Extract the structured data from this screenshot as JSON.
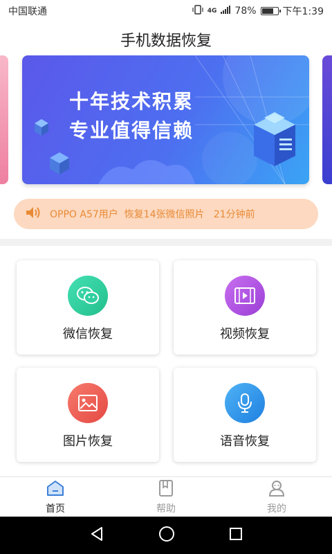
{
  "status_bar": {
    "carrier": "中国联通",
    "network": "4G",
    "battery": "78%",
    "battery_level": 0.78,
    "time": "下午1:39"
  },
  "app": {
    "title": "手机数据恢复"
  },
  "banner": {
    "line1": "十年技术积累",
    "line2": "专业值得信赖"
  },
  "notice": {
    "icon": "speaker-icon",
    "text": "OPPO A57用户  恢复14张微信照片   21分钟前",
    "color": "#e98a36",
    "background": "#fcd9c0"
  },
  "features": [
    {
      "label": "微信恢复",
      "icon": "wechat-icon",
      "color": "#2fcfa0"
    },
    {
      "label": "视频恢复",
      "icon": "video-icon",
      "color": "#b24fe0"
    },
    {
      "label": "图片恢复",
      "icon": "image-icon",
      "color": "#ee5a52"
    },
    {
      "label": "语音恢复",
      "icon": "microphone-icon",
      "color": "#2a8fe8"
    }
  ],
  "bottom_nav": [
    {
      "label": "首页",
      "icon": "home-icon",
      "active": true
    },
    {
      "label": "帮助",
      "icon": "book-icon",
      "active": false
    },
    {
      "label": "我的",
      "icon": "user-icon",
      "active": false
    }
  ],
  "colors": {
    "active_tab": "#3a7fd8",
    "inactive_tab": "#9a9a9a"
  }
}
